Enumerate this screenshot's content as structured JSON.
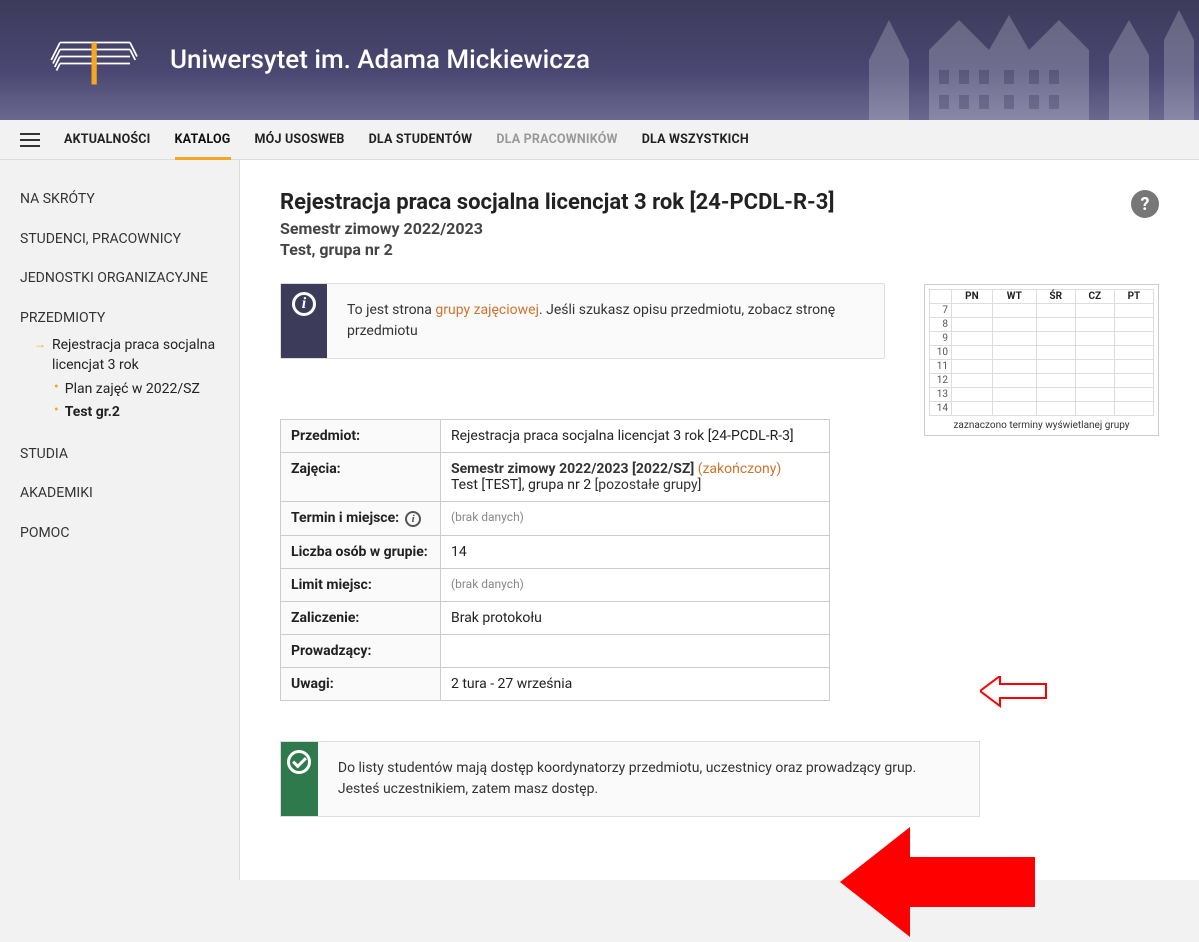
{
  "header": {
    "university": "Uniwersytet im. Adama Mickiewicza"
  },
  "topnav": {
    "items": [
      {
        "label": "AKTUALNOŚCI"
      },
      {
        "label": "KATALOG"
      },
      {
        "label": "MÓJ USOSWEB"
      },
      {
        "label": "DLA STUDENTÓW"
      },
      {
        "label": "DLA PRACOWNIKÓW"
      },
      {
        "label": "DLA WSZYSTKICH"
      }
    ]
  },
  "sidebar": {
    "shortcuts": "NA SKRÓTY",
    "people": "STUDENCI, PRACOWNICY",
    "units": "JEDNOSTKI ORGANIZACYJNE",
    "courses": "PRZEDMIOTY",
    "tree": {
      "course": "Rejestracja praca socjalna licencjat 3 rok",
      "plan": "Plan zajęć w 2022/SZ",
      "current": "Test gr.2"
    },
    "studies": "STUDIA",
    "dorms": "AKADEMIKI",
    "help": "POMOC"
  },
  "page": {
    "title": "Rejestracja praca socjalna licencjat 3 rok [24-PCDL-R-3]",
    "sub1": "Semestr zimowy 2022/2023",
    "sub2": "Test, grupa nr 2",
    "help_tooltip": "?"
  },
  "infobox": {
    "prefix": "To jest strona ",
    "link": "grupy zajęciowej",
    "suffix": ". Jeśli szukasz opisu przedmiotu, zobacz stronę przedmiotu"
  },
  "schedule": {
    "days": [
      "PN",
      "WT",
      "ŚR",
      "CZ",
      "PT"
    ],
    "hours": [
      "7",
      "8",
      "9",
      "10",
      "11",
      "12",
      "13",
      "14"
    ],
    "caption": "zaznaczono terminy wyświetlanej grupy"
  },
  "details": {
    "rows": {
      "przedmiot": {
        "label": "Przedmiot:",
        "value": "Rejestracja praca socjalna licencjat 3 rok [24-PCDL-R-3]"
      },
      "zajecia": {
        "label": "Zajęcia:",
        "semester": "Semestr zimowy 2022/2023 [2022/SZ]",
        "status": "(zakończony)",
        "line2_pre": "Test [TEST], grupa nr 2 ",
        "line2_link": "[pozostałe grupy]"
      },
      "termin": {
        "label": "Termin i miejsce:",
        "value": "(brak danych)"
      },
      "liczba": {
        "label": "Liczba osób w grupie:",
        "value": "14"
      },
      "limit": {
        "label": "Limit miejsc:",
        "value": "(brak danych)"
      },
      "zaliczenie": {
        "label": "Zaliczenie:",
        "value": "Brak protokołu"
      },
      "prowadzacy": {
        "label": "Prowadzący:",
        "value": ""
      },
      "uwagi": {
        "label": "Uwagi:",
        "value": "2 tura - 27 września"
      }
    }
  },
  "okbox": {
    "text": "Do listy studentów mają dostęp koordynatorzy przedmiotu, uczestnicy oraz prowadzący grup. Jesteś uczestnikiem, zatem masz dostęp."
  }
}
